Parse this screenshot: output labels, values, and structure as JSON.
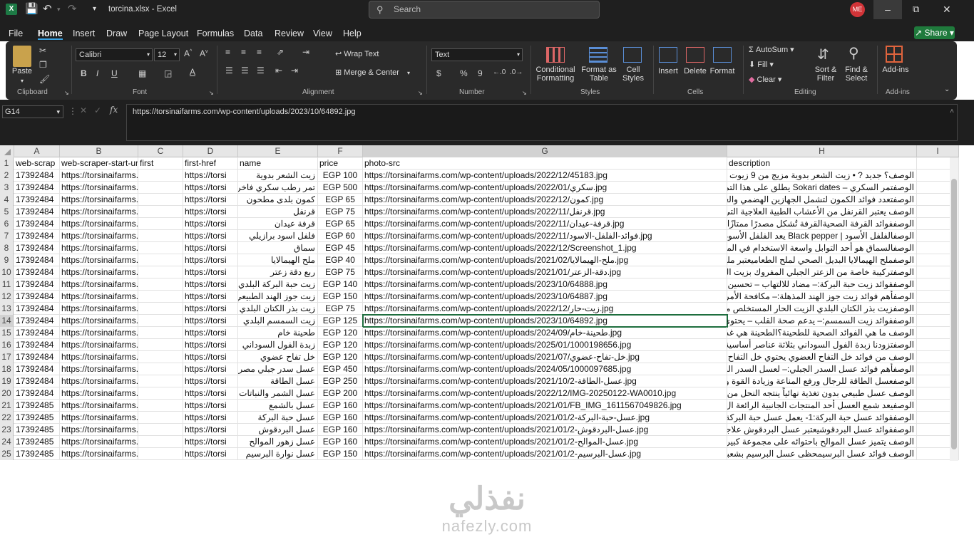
{
  "titlebar": {
    "filename": "torcina.xlsx",
    "separator": "-",
    "app": "Excel",
    "search_placeholder": "Search",
    "user_initials": "ME"
  },
  "menu": {
    "tabs": [
      "File",
      "Home",
      "Insert",
      "Draw",
      "Page Layout",
      "Formulas",
      "Data",
      "Review",
      "View",
      "Help"
    ],
    "active": "Home",
    "share_label": "Share"
  },
  "ribbon": {
    "clipboard": {
      "paste": "Paste",
      "label": "Clipboard"
    },
    "font": {
      "name": "Calibri",
      "size": "12",
      "label": "Font"
    },
    "alignment": {
      "wrap": "Wrap Text",
      "merge": "Merge & Center",
      "label": "Alignment"
    },
    "number": {
      "format": "Text",
      "label": "Number",
      "currency": "$",
      "percent": "%",
      "comma": "9"
    },
    "styles": {
      "conditional": "Conditional Formatting",
      "format_table": "Format as Table",
      "cell_styles": "Cell Styles",
      "label": "Styles"
    },
    "cells": {
      "insert": "Insert",
      "delete": "Delete",
      "format": "Format",
      "label": "Cells"
    },
    "editing": {
      "autosum": "AutoSum",
      "fill": "Fill",
      "clear": "Clear",
      "sort": "Sort & Filter",
      "find": "Find & Select",
      "label": "Editing"
    },
    "addins": {
      "addins": "Add-ins",
      "label": "Add-ins"
    }
  },
  "formula_bar": {
    "name_box": "G14",
    "fx": "fx",
    "content": "https://torsinaifarms.com/wp-content/uploads/2023/10/64892.jpg"
  },
  "grid": {
    "columns": [
      "A",
      "B",
      "C",
      "D",
      "E",
      "F",
      "G",
      "H",
      "I"
    ],
    "selected_column": "G",
    "selected_row": 14,
    "rows": [
      {
        "n": 1,
        "a": "web-scrap",
        "b": "web-scraper-start-url",
        "c": "first",
        "d": "first-href",
        "e": "name",
        "f": "price",
        "g": "photo-src",
        "h": "description"
      },
      {
        "n": 2,
        "a": "17392484",
        "b": "https://torsinaifarms.com",
        "c": "",
        "d": "https://torsi",
        "e": "زيت الشعر بدوية",
        "f": "EGP 100",
        "g": "https://torsinaifarms.com/wp-content/uploads/2022/12/45183.jpg",
        "h": "الوصف؟ جديد ? • زيت الشعر بدوية مزيج من 9 زيوت"
      },
      {
        "n": 3,
        "a": "17392484",
        "b": "https://torsinaifarms.com",
        "c": "",
        "d": "https://torsi",
        "e": "تمر رطب سكري فاخر",
        "f": "EGP 500",
        "g": "https://torsinaifarms.com/wp-content/uploads/2022/01/سكري.jpg",
        "h": "الوصفتمر السكري – Sokari dates يطلق على هذا التمر"
      },
      {
        "n": 4,
        "a": "17392484",
        "b": "https://torsinaifarms.com",
        "c": "",
        "d": "https://torsi",
        "e": "كمون بلدى مطحون",
        "f": "EGP 65",
        "g": "https://torsinaifarms.com/wp-content/uploads/2022/12/كمون.jpg",
        "h": "الوصفتعدد فوائد الكمون لتشمل الجهازين الهضمي والعص"
      },
      {
        "n": 5,
        "a": "17392484",
        "b": "https://torsinaifarms.com",
        "c": "",
        "d": "https://torsi",
        "e": "قرنفل",
        "f": "EGP 75",
        "g": "https://torsinaifarms.com/wp-content/uploads/2022/11/قرنفل.jpg",
        "h": "الوصف يعتبر القرنفل من الأعشاب الطبية العلاجية التي"
      },
      {
        "n": 6,
        "a": "17392484",
        "b": "https://torsinaifarms.com",
        "c": "",
        "d": "https://torsi",
        "e": "قرفة عيدان",
        "f": "EGP 65",
        "g": "https://torsinaifarms.com/wp-content/uploads/2022/11/قرفة-عيدان.jpg",
        "h": "الوصففوائد القرفة الصحيةالقرفة تُشكل مصدرًا ممتازًا للأ"
      },
      {
        "n": 7,
        "a": "17392484",
        "b": "https://torsinaifarms.com",
        "c": "",
        "d": "https://torsi",
        "e": "فلفل اسود برازيلي",
        "f": "EGP 60",
        "g": "https://torsinaifarms.com/wp-content/uploads/2022/11/فوائد-الفلفل-الاسود.jpg",
        "h": "الوصفالفلفل الأسود | Black pepper يعد الفلفل الأسود"
      },
      {
        "n": 8,
        "a": "17392484",
        "b": "https://torsinaifarms.com",
        "c": "",
        "d": "https://torsi",
        "e": "سماق",
        "f": "EGP 45",
        "g": "https://torsinaifarms.com/wp-content/uploads/2022/12/Screenshot_1.jpg",
        "h": "الوصفالسماق هو أحد التوابل واسعة الاستخدام في المط"
      },
      {
        "n": 9,
        "a": "17392484",
        "b": "https://torsinaifarms.com",
        "c": "",
        "d": "https://torsi",
        "e": "ملح الهيمالايا",
        "f": "EGP 40",
        "g": "https://torsinaifarms.com/wp-content/uploads/2021/02/ملح-الهيمالايا.jpg",
        "h": "الوصفملح الهيمالايا البديل الصحي لملح الطعاميعتبر ملح"
      },
      {
        "n": 10,
        "a": "17392484",
        "b": "https://torsinaifarms.com",
        "c": "",
        "d": "https://torsi",
        "e": "ربع دقة زعتر",
        "f": "EGP 75",
        "g": "https://torsinaifarms.com/wp-content/uploads/2021/01/دقة-الزعتر.jpg",
        "h": "الوصفتركيبة خاصة من الزعتر الجبلي المفروك بزيت الزيتون"
      },
      {
        "n": 11,
        "a": "17392484",
        "b": "https://torsinaifarms.com",
        "c": "",
        "d": "https://torsi",
        "e": "زيت حبة البركة البلدي",
        "f": "EGP 140",
        "g": "https://torsinaifarms.com/wp-content/uploads/2023/10/64888.jpg",
        "h": "الوصففوائد زيت حبة البركة:– مضاد للالتهاب – تحسين"
      },
      {
        "n": 12,
        "a": "17392484",
        "b": "https://torsinaifarms.com",
        "c": "",
        "d": "https://torsi",
        "e": "زيت جوز الهند الطبيعي",
        "f": "EGP 150",
        "g": "https://torsinaifarms.com/wp-content/uploads/2023/10/64887.jpg",
        "h": "الوصفأهم فوائد زيت جوز الهند المذهلة:– مكافحة الأمراض"
      },
      {
        "n": 13,
        "a": "17392484",
        "b": "https://torsinaifarms.com",
        "c": "",
        "d": "https://torsi",
        "e": "زيت بذر الكتان البلدي",
        "f": "EGP 75",
        "g": "https://torsinaifarms.com/wp-content/uploads/2022/12/زيت-حار.jpg",
        "h": "الوصفزيت بذر الكتان البلدي الزيت الحار المستخلص من"
      },
      {
        "n": 14,
        "a": "17392484",
        "b": "https://torsinaifarms.com",
        "c": "",
        "d": "https://torsi",
        "e": "زيت السمسم البلدي",
        "f": "EGP 125",
        "g": "https://torsinaifarms.com/wp-content/uploads/2023/10/64892.jpg",
        "h": "الوصففوائد زيت السمسم:– يدعم صحة القلب – يحتوي"
      },
      {
        "n": 15,
        "a": "17392484",
        "b": "https://torsinaifarms.com",
        "c": "",
        "d": "https://torsi",
        "e": "طحينة خام",
        "f": "EGP 120",
        "g": "https://torsinaifarms.com/wp-content/uploads/2024/09/طحينة-خام.jpg",
        "h": "الوصف ما هي الفوائد الصحية للطحينة؟الطحينة هي غذاء"
      },
      {
        "n": 16,
        "a": "17392484",
        "b": "https://torsinaifarms.com",
        "c": "",
        "d": "https://torsi",
        "e": "زبدة الفول السوداني",
        "f": "EGP 120",
        "g": "https://torsinaifarms.com/wp-content/uploads/2025/01/1000198656.jpg",
        "h": "الوصفتزودنا زبدة الفول السوداني بثلاثة عناصر أساسية مع"
      },
      {
        "n": 17,
        "a": "17392484",
        "b": "https://torsinaifarms.com",
        "c": "",
        "d": "https://torsi",
        "e": "خل تفاح عضوي",
        "f": "EGP 120",
        "g": "https://torsinaifarms.com/wp-content/uploads/2021/07/خل-تفاح-عضوي.jpg",
        "h": "الوصف من فوائد خل التفاح العضوي يحتوي خل التفاح"
      },
      {
        "n": 18,
        "a": "17392484",
        "b": "https://torsinaifarms.com",
        "c": "",
        "d": "https://torsi",
        "e": "عسل سدر جبلي مصري",
        "f": "EGP 450",
        "g": "https://torsinaifarms.com/wp-content/uploads/2024/05/1000097685.jpg",
        "h": "الوصفأهم فوائد عسل السدر الجبلي:– لعسل السدر الجب"
      },
      {
        "n": 19,
        "a": "17392484",
        "b": "https://torsinaifarms.com",
        "c": "",
        "d": "https://torsi",
        "e": "عسل الطاقة",
        "f": "EGP 250",
        "g": "https://torsinaifarms.com/wp-content/uploads/2021/10/عسل-الطاقة-2.jpg",
        "h": "الوصفعسل الطاقة للرجال ورفع المناعة وزيادة القوة وا"
      },
      {
        "n": 20,
        "a": "17392484",
        "b": "https://torsinaifarms.com",
        "c": "",
        "d": "https://torsi",
        "e": "عسل الشمر والنباتات",
        "f": "EGP 200",
        "g": "https://torsinaifarms.com/wp-content/uploads/2022/12/IMG-20250122-WA0010.jpg",
        "h": "الوصف عسل طبيعي بدون تغذية نهائياً ينتجه النحل من"
      },
      {
        "n": 21,
        "a": "17392485",
        "b": "https://torsinaifarms.com",
        "c": "",
        "d": "https://torsi",
        "e": "عسل بالشمع",
        "f": "EGP 160",
        "g": "https://torsinaifarms.com/wp-content/uploads/2021/01/FB_IMG_1611567049826.jpg",
        "h": "الوصفيعد شمع العسل أحد المنتجات الجانبية الرائعة ال"
      },
      {
        "n": 22,
        "a": "17392485",
        "b": "https://torsinaifarms.com",
        "c": "",
        "d": "https://torsi",
        "e": "عسل حبة البركة",
        "f": "EGP 160",
        "g": "https://torsinaifarms.com/wp-content/uploads/2021/01/عسل-حبة-البركة-2.jpg",
        "h": "الوصففوائد عسل حبة البركة:1- يعمل عسل حبة البركة ع"
      },
      {
        "n": 23,
        "a": "17392485",
        "b": "https://torsinaifarms.com",
        "c": "",
        "d": "https://torsi",
        "e": "عسل البردقوش",
        "f": "EGP 160",
        "g": "https://torsinaifarms.com/wp-content/uploads/2021/01/عسل-البردقوش-2.jpg",
        "h": "الوصففوائد عسل البردقوشيعتبر عسل البردقوش علاجاً فع"
      },
      {
        "n": 24,
        "a": "17392485",
        "b": "https://torsinaifarms.com",
        "c": "",
        "d": "https://torsi",
        "e": "عسل زهور الموالح",
        "f": "EGP 160",
        "g": "https://torsinaifarms.com/wp-content/uploads/2021/01/عسل-الموالح-2.jpg",
        "h": "الوصف يتميز عسل الموالح باحتوائه على مجموعة كبيرة"
      },
      {
        "n": 25,
        "a": "17392485",
        "b": "https://torsinaifarms.com",
        "c": "",
        "d": "https://torsi",
        "e": "عسل نوارة البرسيم",
        "f": "EGP 150",
        "g": "https://torsinaifarms.com/wp-content/uploads/2021/01/عسل-البرسيم-2.jpg",
        "h": "الوصف فوائد عسل البرسيمحظى عسل البرسيم بشعبية"
      }
    ]
  },
  "watermark": {
    "arabic": "نفذلي",
    "latin": "nafezly.com"
  },
  "colors": {
    "titlebar": "#1f1f1f",
    "ribbon": "#2a2a2a",
    "accent": "#1e6e3e",
    "share": "#1f7a3c"
  }
}
